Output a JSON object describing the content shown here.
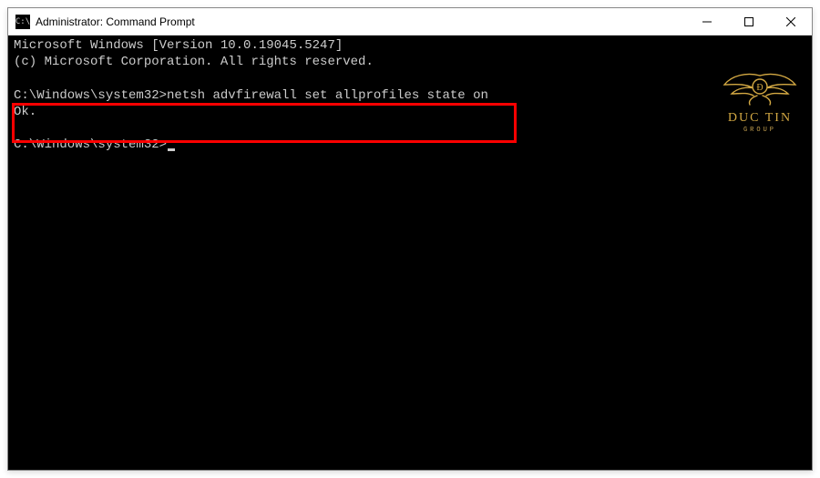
{
  "titlebar": {
    "icon_glyph": "C:\\",
    "title": "Administrator: Command Prompt"
  },
  "terminal": {
    "line_version": "Microsoft Windows [Version 10.0.19045.5247]",
    "line_copyright": "(c) Microsoft Corporation. All rights reserved.",
    "prompt1_path": "C:\\Windows\\system32>",
    "prompt1_command": "netsh advfirewall set allprofiles state on",
    "result1": "Ok.",
    "prompt2_path": "C:\\Windows\\system32>"
  },
  "watermark": {
    "name": "DUC TIN",
    "sub": "GROUP"
  }
}
